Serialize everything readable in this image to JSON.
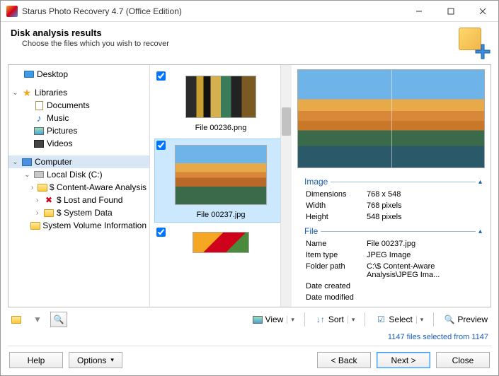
{
  "window": {
    "title": "Starus Photo Recovery 4.7 (Office Edition)"
  },
  "header": {
    "title": "Disk analysis results",
    "subtitle": "Choose the files which you wish to recover"
  },
  "tree": {
    "desktop": "Desktop",
    "libraries": "Libraries",
    "documents": "Documents",
    "music": "Music",
    "pictures": "Pictures",
    "videos": "Videos",
    "computer": "Computer",
    "local_disk": "Local Disk (C:)",
    "caa": "$ Content-Aware Analysis",
    "laf": "$ Lost and Found",
    "sysdata": "$ System Data",
    "svi": "System Volume Information"
  },
  "files": [
    {
      "name": "File 00236.png",
      "checked": true
    },
    {
      "name": "File 00237.jpg",
      "checked": true,
      "selected": true
    },
    {
      "name": "",
      "checked": true
    }
  ],
  "preview": {
    "groups": {
      "image": {
        "label": "Image"
      },
      "file": {
        "label": "File"
      }
    },
    "props": {
      "dimensions_l": "Dimensions",
      "dimensions_v": "768 x 548",
      "width_l": "Width",
      "width_v": "768 pixels",
      "height_l": "Height",
      "height_v": "548 pixels",
      "name_l": "Name",
      "name_v": "File 00237.jpg",
      "itemtype_l": "Item type",
      "itemtype_v": "JPEG Image",
      "folder_l": "Folder path",
      "folder_v": "C:\\$ Content-Aware Analysis\\JPEG Ima...",
      "datec_l": "Date created",
      "datec_v": "",
      "datem_l": "Date modified",
      "datem_v": ""
    }
  },
  "toolbar": {
    "view": "View",
    "sort": "Sort",
    "select": "Select",
    "preview": "Preview"
  },
  "status": "1147 files selected from 1147",
  "buttons": {
    "help": "Help",
    "options": "Options",
    "back": "< Back",
    "next": "Next >",
    "close": "Close"
  }
}
